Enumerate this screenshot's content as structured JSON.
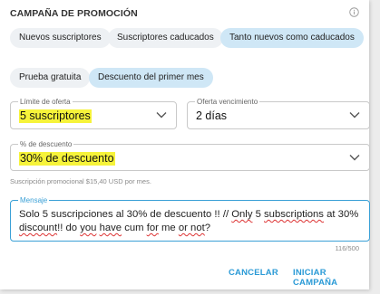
{
  "dialog": {
    "title": "CAMPAÑA DE PROMOCIÓN",
    "audience_chips": [
      {
        "label": "Nuevos suscriptores",
        "active": false
      },
      {
        "label": "Suscriptores caducados",
        "active": false
      },
      {
        "label": "Tanto nuevos como caducados",
        "active": true
      }
    ],
    "type_chips": [
      {
        "label": "Prueba gratuita",
        "active": false
      },
      {
        "label": "Descuento del primer mes",
        "active": true
      }
    ],
    "offer_limit": {
      "label": "Límite de oferta",
      "value": "5 suscriptores"
    },
    "offer_expiry": {
      "label": "Oferta vencimiento",
      "value": "2 días"
    },
    "discount": {
      "label": "% de descuento",
      "value": "30% de descuento"
    },
    "hint": "Suscripción promocional $15,40 USD por mes.",
    "message": {
      "label": "Mensaje",
      "parts": [
        "Solo 5 suscripciones al 30% de descuento !! // ",
        "Only",
        " 5 ",
        "subscriptions",
        " at 30% ",
        "discount",
        "!! do ",
        "you",
        " ",
        "have",
        " cum ",
        "for",
        " me ",
        "or not",
        "?"
      ]
    },
    "counter": "116/500",
    "cancel_label": "CANCELAR",
    "start_label": "INICIAR CAMPAÑA"
  },
  "colors": {
    "accent": "#2a9ad6",
    "chip_active": "#cfe7f6",
    "highlight": "#f6f33a"
  },
  "icons": [
    "info-icon",
    "chevron-down-icon"
  ]
}
